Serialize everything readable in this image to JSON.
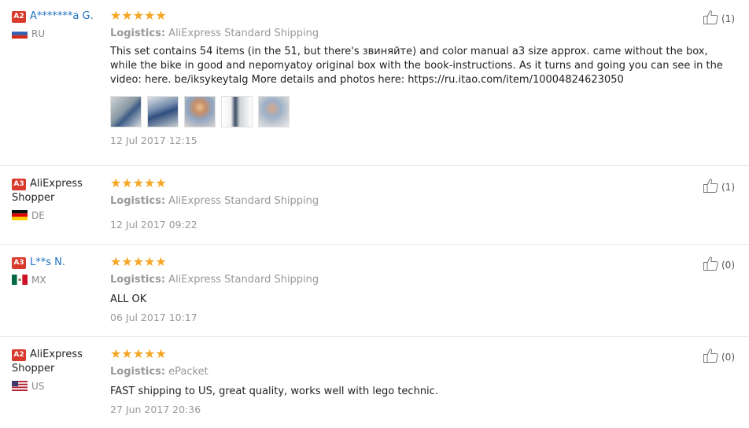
{
  "reviews": [
    {
      "badge": "A2",
      "name": "A*******a G.",
      "country": "RU",
      "stars": "★★★★★",
      "logistics_label": "Logistics:",
      "logistics_value": "AliExpress Standard Shipping",
      "text": "This set contains 54 items (in the 51, but there's звиняйте) and color manual a3 size approx. came without the box, while the bike in good and nepomyatoy original box with the book-instructions. As it turns and going you can see in the video: here. be/iksykeytalg More details and photos here: https://ru.itao.com/item/10004824623050",
      "date": "12 Jul 2017 12:15",
      "helpful_count": "(1)"
    },
    {
      "badge": "A3",
      "name": "AliExpress Shopper",
      "country": "DE",
      "stars": "★★★★★",
      "logistics_label": "Logistics:",
      "logistics_value": "AliExpress Standard Shipping",
      "date": "12 Jul 2017 09:22",
      "helpful_count": "(1)"
    },
    {
      "badge": "A3",
      "name": "L**s N.",
      "country": "MX",
      "stars": "★★★★★",
      "logistics_label": "Logistics:",
      "logistics_value": "AliExpress Standard Shipping",
      "text": "ALL OK",
      "date": "06 Jul 2017 10:17",
      "helpful_count": "(0)"
    },
    {
      "badge": "A2",
      "name": "AliExpress Shopper",
      "country": "US",
      "stars": "★★★★★",
      "logistics_label": "Logistics:",
      "logistics_value": "ePacket",
      "text": "FAST shipping to US, great quality, works well with lego technic.",
      "date": "27 Jun 2017 20:36",
      "helpful_count": "(0)"
    }
  ],
  "colors": {
    "badge": "#d83a2c",
    "star": "#f5a623",
    "link": "#1e70c2"
  },
  "icons": {
    "helpful": "thumbs-up-icon"
  }
}
